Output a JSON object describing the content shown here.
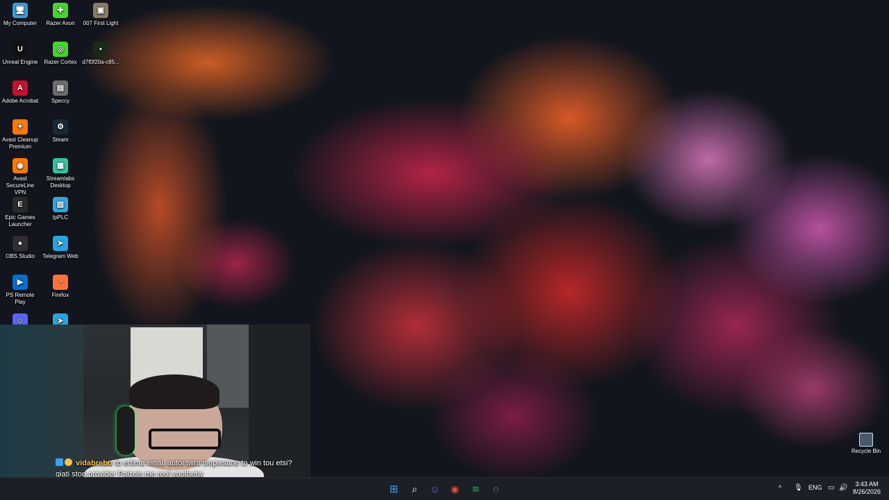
{
  "desktop": {
    "icons": [
      {
        "label": "My Computer",
        "icon": "monitor-icon",
        "color": "#3a9bdc",
        "glyph": "🖥"
      },
      {
        "label": "Razer Axon",
        "icon": "razer-axon-icon",
        "color": "#44d62c",
        "glyph": "✚"
      },
      {
        "label": "007 First Light",
        "icon": "game-icon",
        "color": "#8a7b66",
        "glyph": "▣"
      },
      {
        "label": "Unreal Engine",
        "icon": "unreal-icon",
        "color": "#111111",
        "glyph": "U"
      },
      {
        "label": "Razer Cortex",
        "icon": "razer-cortex-icon",
        "color": "#44d62c",
        "glyph": "◎"
      },
      {
        "label": "d7f0f20a-c85...",
        "icon": "file-icon",
        "color": "#1a2a1a",
        "glyph": "▪"
      },
      {
        "label": "Adobe Acrobat",
        "icon": "acrobat-icon",
        "color": "#c8102e",
        "glyph": "A"
      },
      {
        "label": "Speccy",
        "icon": "speccy-icon",
        "color": "#6d6d6d",
        "glyph": "▤"
      },
      {
        "label": "Avast Cleanup Premium",
        "icon": "avast-cleanup-icon",
        "color": "#ff7800",
        "glyph": "✦"
      },
      {
        "label": "Steam",
        "icon": "steam-icon",
        "color": "#1b2838",
        "glyph": "⚙"
      },
      {
        "label": "Avast SecureLine VPN",
        "icon": "avast-vpn-icon",
        "color": "#ff7800",
        "glyph": "◉"
      },
      {
        "label": "Streamlabs Desktop",
        "icon": "streamlabs-icon",
        "color": "#31c3a2",
        "glyph": "▦"
      },
      {
        "label": "Epic Games Launcher",
        "icon": "epic-games-icon",
        "color": "#2a2a2a",
        "glyph": "E"
      },
      {
        "label": "tpPLC",
        "icon": "tpplc-icon",
        "color": "#2fa8e0",
        "glyph": "▧"
      },
      {
        "label": "OBS Studio",
        "icon": "obs-icon",
        "color": "#302e31",
        "glyph": "●"
      },
      {
        "label": "Telegram Web",
        "icon": "telegram-icon",
        "color": "#2aa3de",
        "glyph": "➤"
      },
      {
        "label": "PS Remote Play",
        "icon": "ps-remote-icon",
        "color": "#0070d1",
        "glyph": "▶"
      },
      {
        "label": "Firefox",
        "icon": "firefox-icon",
        "color": "#ff7139",
        "glyph": "◔"
      },
      {
        "label": "",
        "icon": "discord-icon",
        "color": "#5865f2",
        "glyph": "☺"
      },
      {
        "label": "",
        "icon": "telegram-icon",
        "color": "#2aa3de",
        "glyph": "➤"
      }
    ],
    "recycle_bin": {
      "label": "Recycle Bin",
      "icon": "recycle-bin-icon"
    }
  },
  "chat": {
    "username": "vidabrebo",
    "message": "to ertima einai, autoi twra tsepwsane to win tou etsi? giati ston provider Paizeis me real ynothetw",
    "badge_colors": [
      "#3aa0ff",
      "#f2c14e"
    ]
  },
  "taskbar": {
    "apps": [
      {
        "name": "start-button",
        "icon": "windows-icon",
        "color": "#3aa6ff",
        "glyph": "⊞"
      },
      {
        "name": "search-button",
        "icon": "search-icon",
        "color": "#ffffff",
        "glyph": "⌕"
      },
      {
        "name": "discord-taskbar",
        "icon": "discord-icon",
        "color": "#5865f2",
        "glyph": "☺"
      },
      {
        "name": "chrome-taskbar",
        "icon": "chrome-icon",
        "color": "#e74c3c",
        "glyph": "◉"
      },
      {
        "name": "spotify-taskbar",
        "icon": "spotify-icon",
        "color": "#1db954",
        "glyph": "≋"
      },
      {
        "name": "obs-taskbar",
        "icon": "obs-icon",
        "color": "#cccccc",
        "glyph": "◌"
      }
    ],
    "tray": {
      "chevron": "^",
      "language": "ENG"
    },
    "clock": {
      "time": "3:43 AM",
      "date": "8/26/2026"
    }
  }
}
